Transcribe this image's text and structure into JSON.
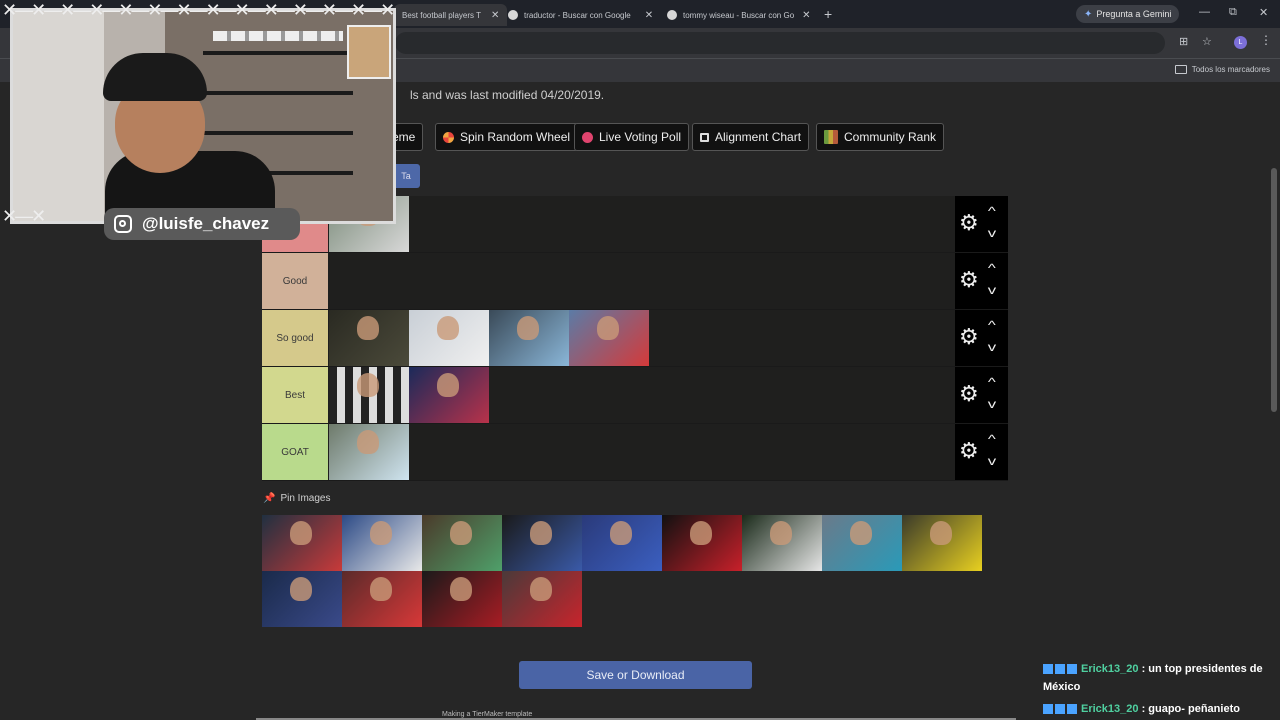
{
  "browser": {
    "tabs": [
      {
        "title": "Best football players T",
        "active": true
      },
      {
        "title": "traductor - Buscar con Google",
        "active": false
      },
      {
        "title": "tommy wiseau - Buscar con Go",
        "active": false
      }
    ],
    "new_tab": "+",
    "gemini_label": "Pregunta a Gemini",
    "profile_initial": "L",
    "bookmarks_all": "Todos los marcadores"
  },
  "page": {
    "info_text": "ls and was last modified 04/20/2019.",
    "tools": [
      {
        "label": "eme",
        "icon": "theme-icon"
      },
      {
        "label": "Spin Random Wheel",
        "icon": "wheel-icon"
      },
      {
        "label": "Live Voting Poll",
        "icon": "poll-icon"
      },
      {
        "label": "Alignment Chart",
        "icon": "grid-icon"
      },
      {
        "label": "Community Rank",
        "icon": "rank-icon"
      }
    ],
    "blue_button_label": "Ta",
    "tiers": [
      {
        "label": "",
        "color": "#e08a8a",
        "items": 1
      },
      {
        "label": "Good",
        "color": "#d1b199",
        "items": 0
      },
      {
        "label": "So good",
        "color": "#d5c98b",
        "items": 4
      },
      {
        "label": "Best",
        "color": "#d2d88e",
        "items": 2
      },
      {
        "label": "GOAT",
        "color": "#b9da8c",
        "items": 1
      }
    ],
    "pin_images_label": "Pin Images",
    "pool_count": 13,
    "save_button": "Save or Download",
    "footer_note": "Making a TierMaker template"
  },
  "stream": {
    "handle": "@luisfe_chavez",
    "chat": [
      {
        "user": "Erick13_20",
        "message": ": un top presidentes de México"
      },
      {
        "user": "Erick13_20",
        "message": ": guapo- peñanieto"
      }
    ]
  },
  "colors": {
    "accent_blue": "#4a64a6",
    "chat_user": "#4fd0a0"
  }
}
